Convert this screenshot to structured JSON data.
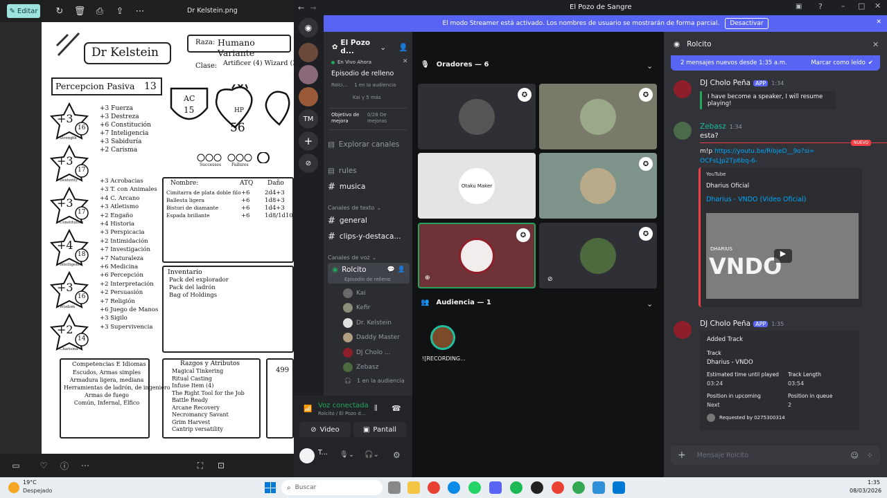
{
  "viewer": {
    "edit_label": "Editar",
    "file_name": "Dr Kelstein.png",
    "sheet": {
      "name": "Dr Kelstein",
      "race_label": "Raza:",
      "race": "Humano Variante",
      "class_label": "Clase:",
      "class": "Artificer (4) Wizard (3",
      "passive_label": "Percepcion Pasiva",
      "passive": "13",
      "ac_label": "AC",
      "ac": "15",
      "hp_label": "HP",
      "hp": "56",
      "successes": "Successes",
      "failures": "Failures",
      "ability_scores": [
        {
          "mod": "+3",
          "score": "16",
          "name": "Strength"
        },
        {
          "mod": "+3",
          "score": "17",
          "name": "Dexterity"
        },
        {
          "mod": "+3",
          "score": "17",
          "name": "Constitution"
        },
        {
          "mod": "+4",
          "score": "18",
          "name": "Intelligence"
        },
        {
          "mod": "+3",
          "score": "16",
          "name": "Wisdom"
        },
        {
          "mod": "+2",
          "score": "14",
          "name": "Charisma"
        }
      ],
      "saves": [
        "+3 Fuerza",
        "+3 Destreza",
        "+6 Constitución",
        "+7 Inteligencia",
        "+3 Sabiduría",
        "+2 Carisma"
      ],
      "skills": [
        "+3 Acrobacias",
        "+3 T. con Animales",
        "+4 C. Arcano",
        "+3 Atletismo",
        "+2 Engaño",
        "+4 Historia",
        "+3 Perspicacia",
        "+2 Intimidación",
        "+7 Investigación",
        "+7 Naturaleza",
        "+6 Medicina",
        "+6 Percepción",
        "+2 Interpretación",
        "+2 Persuasión",
        "+7 Religión",
        "+6 Juego de Manos",
        "+3 Sigilo",
        "+3 Supervivencia"
      ],
      "weapons_headers": [
        "Nombre:",
        "ATQ",
        "Daño"
      ],
      "weapons": [
        [
          "Cimitarra de plata doble filo",
          "+6",
          "2d4+3"
        ],
        [
          "Ballesta ligera",
          "+6",
          "1d8+3"
        ],
        [
          "Bisturí de diamante",
          "+6",
          "1d4+3"
        ],
        [
          "Espada brillante",
          "+6",
          "1d8/1d10"
        ]
      ],
      "inventory_title": "Inventario",
      "inventory": [
        "Pack del explorador",
        "Pack del ladrón",
        "Bag of Holdings"
      ],
      "prof_title": "Competencias E Idiomas",
      "prof": [
        "Escudos, Armas simples",
        "Armadura ligera, mediana",
        "Herramientas de ladrón, de ingeniero",
        "Armas de fuego",
        "Común, Infernal, Élfico"
      ],
      "traits_title": "Razgos y Atributos",
      "traits": [
        "Magical Tinkering",
        "Ritual Casting",
        "Infuse Item (4)",
        "The Right Tool for the Job",
        "Battle Ready",
        "Arcane Recovery",
        "Necromancy Savant",
        "Grim Harvest",
        "Cantrip versatility"
      ],
      "gold": "499"
    }
  },
  "discord": {
    "window_title": "El Pozo de Sangre",
    "banner_text": "El modo Streamer está activado. Los nombres de usuario se mostrarán de forma parcial.",
    "banner_button": "Desactivar",
    "server_name": "El Pozo d...",
    "live_now": "En Vivo Ahora",
    "event_title": "Episodio de relleno",
    "event_meta": "Rolci...",
    "event_audience": "1 en la audiencia",
    "event_members": "Kai y 5 más",
    "goal_label": "Objetivo de mejora",
    "goal_value": "0/28 De mejoras",
    "explore": "Explorar canales",
    "channels_top": [
      "rules",
      "musica"
    ],
    "text_category": "Canales de texto",
    "text_channels": [
      "general",
      "clips-y-destaca..."
    ],
    "voice_category": "Canales de voz",
    "voice_channel": "Rolcito",
    "voice_channel_sub": "Episodio de relleno",
    "voice_users": [
      "Kai",
      "Kefir",
      "Dr. Kelstein",
      "Daddy Master",
      "DJ Cholo ...",
      "Zebasz"
    ],
    "voice_audience": "1 en la audiencia",
    "voice_connected": "Voz conectada",
    "voice_location": "Rolcito / El Pozo d...",
    "video_btn": "Video",
    "screen_btn": "Pantall",
    "user_short": "T...",
    "guild_tm": "TM",
    "speakers_header": "Oradores — 6",
    "audience_header": "Audiencia — 1",
    "audience_member": "![RECORDING...",
    "otaku_label": "Otaku Maker",
    "chat_title": "Rolcito",
    "new_messages": "2 mensajes nuevos desde 1:35 a.m.",
    "mark_read": "Marcar como leído",
    "new_tag": "NUEVO",
    "app_tag": "APP",
    "messages": [
      {
        "author": "DJ Cholo Peña",
        "time": "1:34",
        "text": "I have become a speaker, I will resume playing!"
      },
      {
        "author": "Zebasz",
        "time": "1:34",
        "text": "esta?",
        "text2": "m!p",
        "link": "https://youtu.be/RibjeD__9o?si=OCFsLJp2Tp6bq-6-"
      },
      {
        "author": "DJ Cholo Peña",
        "time": "1:35"
      }
    ],
    "yt": {
      "source": "YouTube",
      "channel": "Dharius Oficial",
      "title": "Dharius - VNDO (Video Oficial)",
      "thumb_text": "VNDO",
      "thumb_small": "DHARIUS"
    },
    "track": {
      "heading": "Added Track",
      "track_label": "Track",
      "track_value": "Dharius - VNDO",
      "eta_label": "Estimated time until played",
      "eta_value": "03:24",
      "len_label": "Track Length",
      "len_value": "03:54",
      "pos_up_label": "Position in upcoming",
      "pos_up_value": "Next",
      "pos_q_label": "Position in queue",
      "pos_q_value": "2",
      "requested": "Requested by 0275300314"
    },
    "input_placeholder": "Mensaje Rolcito"
  },
  "taskbar": {
    "weather": "19°C",
    "weather_sub": "Despejado",
    "search": "Buscar",
    "time": "1:35",
    "date": "08/03/2026"
  },
  "colors": {
    "blurple": "#5865f2",
    "green": "#23a55a",
    "red": "#f23f43",
    "dark": "#1e1f22"
  }
}
